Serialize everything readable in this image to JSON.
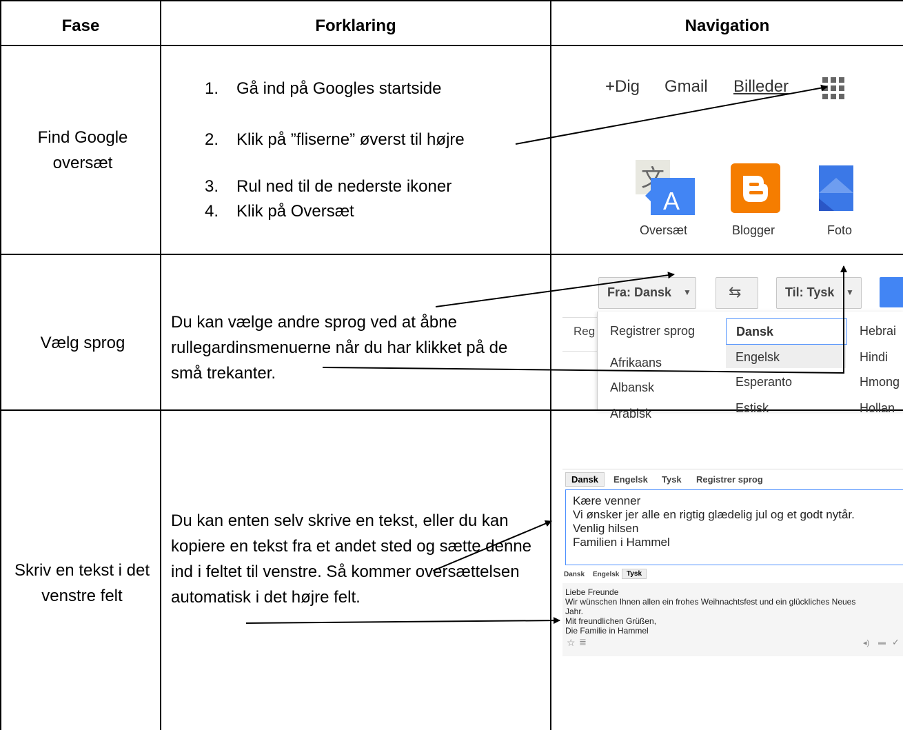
{
  "headers": {
    "fase": "Fase",
    "forklaring": "Forklaring",
    "navigation": "Navigation"
  },
  "row1": {
    "phase": "Find Google oversæt",
    "steps": [
      {
        "num": "1.",
        "text": "Gå ind på Googles startside"
      },
      {
        "num": "2.",
        "text": "Klik på ”fliserne” øverst til højre"
      },
      {
        "num": "3.",
        "text": "Rul ned til de nederste ikoner"
      },
      {
        "num": "4.",
        "text": "Klik på Oversæt"
      }
    ],
    "nav": {
      "links": [
        "+Dig",
        "Gmail",
        "Billeder"
      ],
      "apps": [
        "Oversæt",
        "Blogger",
        "Foto"
      ],
      "colors": {
        "blogger": "#f57d00",
        "translate_blue": "#4285f4",
        "photos_blue": "#3b78e7"
      }
    }
  },
  "row2": {
    "phase": "Vælg sprog",
    "explanation": "Du kan vælge andre sprog ved at åbne rullegardinsmenuerne når du har klikket på de små trekanter.",
    "nav": {
      "from_label": "Fra: Dansk",
      "to_label": "Til: Tysk",
      "side_label": "Reg",
      "col1": [
        "Registrer sprog",
        "Afrikaans",
        "Albansk",
        "Arabisk"
      ],
      "col2": [
        "Dansk",
        "Engelsk",
        "Esperanto",
        "Estisk"
      ],
      "col3": [
        "Hebrai",
        "Hindi",
        "Hmong",
        "Hollan"
      ],
      "selected": "Dansk"
    }
  },
  "row3": {
    "phase": "Skriv en tekst i det venstre felt",
    "explanation": "Du kan enten selv skrive en tekst, eller du kan kopiere en tekst fra et andet sted og sætte denne ind i feltet til venstre. Så kommer oversættelsen automatisk i det højre felt.",
    "nav": {
      "source_tabs": [
        "Dansk",
        "Engelsk",
        "Tysk",
        "Registrer sprog"
      ],
      "source_lines": [
        "Kære venner",
        "Vi ønsker jer alle en rigtig glædelig jul og et godt nytår.",
        "Venlig hilsen",
        "Familien i Hammel"
      ],
      "target_tabs": [
        "Dansk",
        "Engelsk",
        "Tysk"
      ],
      "target_lines": [
        "Liebe Freunde",
        "Wir wünschen Ihnen allen ein frohes Weihnachtsfest und ein glückliches Neues",
        "Jahr.",
        "Mit freundlichen Grüßen,",
        "Die Familie in Hammel"
      ],
      "icons": [
        "star-icon",
        "list-icon",
        "speaker-icon",
        "comment-icon",
        "check-icon"
      ]
    }
  }
}
